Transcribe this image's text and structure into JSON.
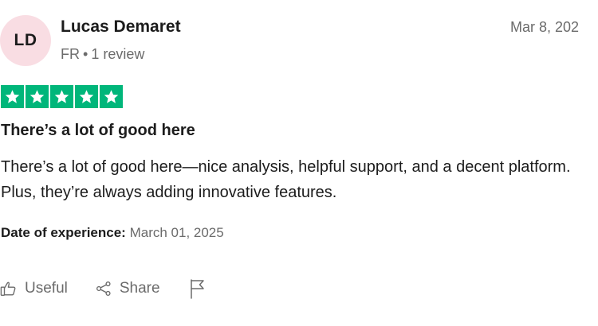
{
  "reviewer": {
    "initials": "LD",
    "name": "Lucas Demaret",
    "country": "FR",
    "review_count": "1 review"
  },
  "review": {
    "date": "Mar 8, 202",
    "rating": 5,
    "rating_color": "#00b67a",
    "title": "There’s a lot of good here",
    "body": "There’s a lot of good here—nice analysis, helpful support, and a decent platform. Plus, they’re always adding innovative features.",
    "experience_label": "Date of experience:",
    "experience_date": "March 01, 2025"
  },
  "actions": {
    "useful_label": "Useful",
    "useful_icon": "thumbs-up-icon",
    "share_label": "Share",
    "share_icon": "share-icon",
    "report_icon": "flag-icon"
  },
  "colors": {
    "avatar_bg": "#f9dde3",
    "muted_text": "#6b6b6b"
  }
}
